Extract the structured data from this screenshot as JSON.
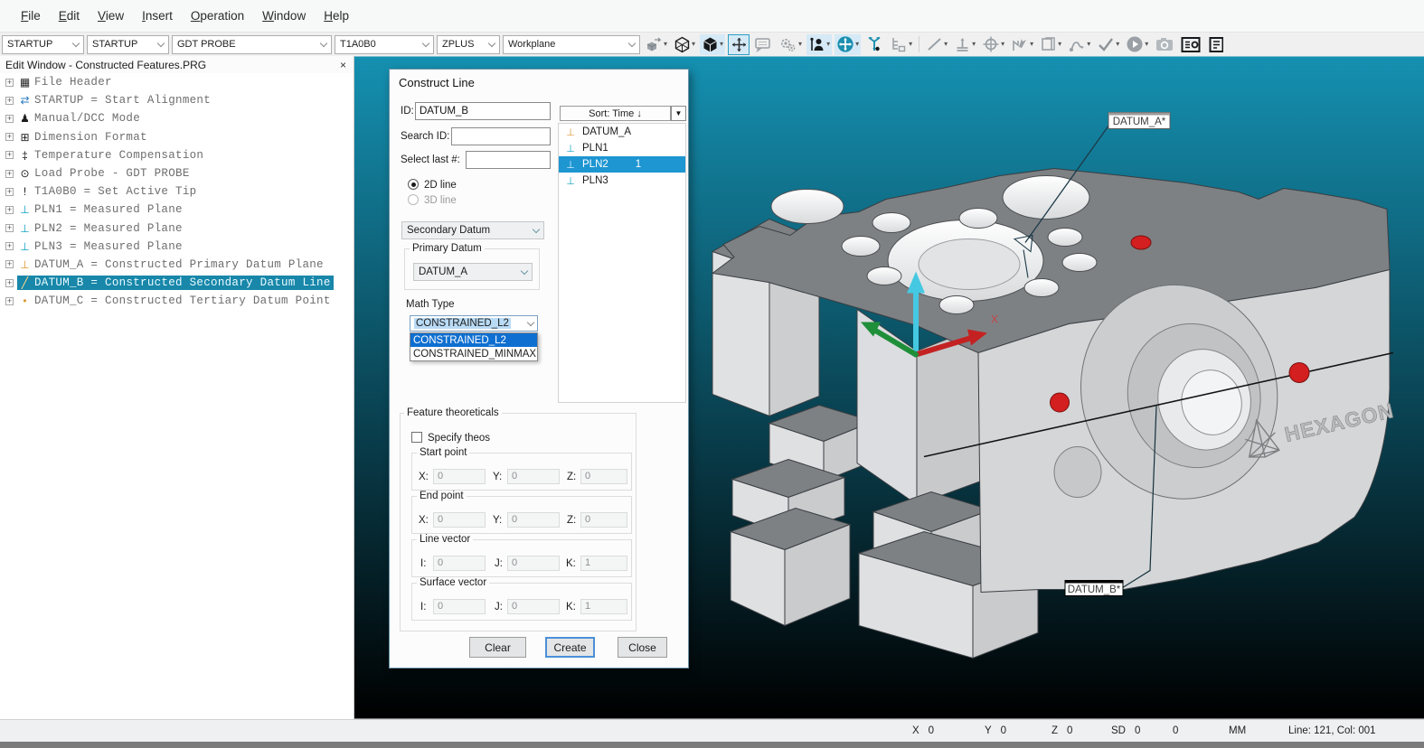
{
  "menu": {
    "items": [
      {
        "label": "File"
      },
      {
        "label": "Edit"
      },
      {
        "label": "View"
      },
      {
        "label": "Insert"
      },
      {
        "label": "Operation"
      },
      {
        "label": "Window"
      },
      {
        "label": "Help"
      }
    ]
  },
  "toolbar": {
    "caret_glyph": "▾",
    "combos": [
      {
        "value": "STARTUP"
      },
      {
        "value": "STARTUP"
      },
      {
        "value": "GDT PROBE"
      },
      {
        "value": "T1A0B0"
      },
      {
        "value": "ZPLUS"
      },
      {
        "value": "Workplane"
      }
    ],
    "icons": [
      "view-orientation-icon",
      "wireframe-view-icon",
      "solid-view-icon",
      "pan-view-icon",
      "comment-icon",
      "settings-gears-icon",
      "manual-mode-icon",
      "machine-move-icon",
      "probe-vector-icon",
      "feature-tree-icon",
      "line-feature-icon",
      "perpendicular-feature-icon",
      "target-feature-icon",
      "move-vector-icon",
      "copy-window-icon",
      "path-icon",
      "check-icon",
      "execute-icon",
      "camera-icon",
      "report-window-icon",
      "edit-window-icon"
    ]
  },
  "tree": {
    "title": "Edit Window - Constructed Features.PRG",
    "close_glyph": "×",
    "expander_glyph": "+",
    "items": [
      {
        "icon": "file-header-icon",
        "glyph": "▦",
        "label": "File Header"
      },
      {
        "icon": "alignment-icon",
        "glyph": "⇄",
        "label": "STARTUP = Start Alignment"
      },
      {
        "icon": "manual-dcc-icon",
        "glyph": "♟",
        "label": "Manual/DCC Mode"
      },
      {
        "icon": "dimension-icon",
        "glyph": "⊞",
        "label": "Dimension Format"
      },
      {
        "icon": "temperature-icon",
        "glyph": "‡",
        "label": "Temperature Compensation"
      },
      {
        "icon": "load-probe-icon",
        "glyph": "⊙",
        "label": "Load Probe - GDT PROBE"
      },
      {
        "icon": "active-tip-icon",
        "glyph": "!",
        "label": "T1A0B0 = Set Active Tip"
      },
      {
        "icon": "measured-plane-icon",
        "glyph": "⊥",
        "label": "PLN1 = Measured Plane"
      },
      {
        "icon": "measured-plane-icon",
        "glyph": "⊥",
        "label": "PLN2 = Measured Plane"
      },
      {
        "icon": "measured-plane-icon",
        "glyph": "⊥",
        "label": "PLN3 = Measured Plane"
      },
      {
        "icon": "datum-plane-icon",
        "glyph": "⊥",
        "label": "DATUM_A = Constructed Primary Datum Plane"
      },
      {
        "icon": "datum-line-icon",
        "glyph": "╱",
        "label": "DATUM_B = Constructed Secondary Datum Line",
        "selected": true
      },
      {
        "icon": "datum-point-icon",
        "glyph": "•",
        "label": "DATUM_C = Constructed Tertiary Datum Point"
      }
    ]
  },
  "dialog": {
    "title": "Construct Line",
    "id_label": "ID:",
    "id_value": "DATUM_B",
    "search_label": "Search ID:",
    "select_last_label": "Select last #:",
    "radio_2d": "2D line",
    "radio_3d": "3D line",
    "secondary_combo": "Secondary Datum",
    "primary_group": "Primary Datum",
    "primary_value": "DATUM_A",
    "math_label": "Math Type",
    "math_value": "CONSTRAINED_L2",
    "math_options": [
      {
        "label": "CONSTRAINED_L2",
        "selected": true
      },
      {
        "label": "CONSTRAINED_MINMAX"
      }
    ],
    "sort_label": "Sort: Time ↓",
    "sort_caret": "▼",
    "list": [
      {
        "glyph": "⊥",
        "name": "DATUM_A",
        "type": "constructed-datum"
      },
      {
        "glyph": "⊥",
        "name": "PLN1",
        "type": "measured"
      },
      {
        "glyph": "⊥",
        "name": "PLN2",
        "count": "1",
        "type": "measured",
        "selected": true
      },
      {
        "glyph": "⊥",
        "name": "PLN3",
        "type": "measured"
      }
    ],
    "theo_group": "Feature theoreticals",
    "specify_theos": "Specify theos",
    "start_group": "Start point",
    "end_group": "End point",
    "line_group": "Line vector",
    "surface_group": "Surface vector",
    "lbl": {
      "x": "X:",
      "y": "Y:",
      "z": "Z:",
      "i": "I:",
      "j": "J:",
      "k": "K:"
    },
    "start": {
      "x": "0",
      "y": "0",
      "z": "0"
    },
    "end": {
      "x": "0",
      "y": "0",
      "z": "0"
    },
    "line_vec": {
      "i": "0",
      "j": "0",
      "k": "1"
    },
    "surf_vec": {
      "i": "0",
      "j": "0",
      "k": "1"
    },
    "buttons": {
      "clear": "Clear",
      "create": "Create",
      "close": "Close"
    }
  },
  "viewport": {
    "bg_color": "#1489a9",
    "labels": {
      "datum_a": "DATUM_A*",
      "datum_b": "DATUM_B*"
    },
    "logo": "HEXAGON",
    "axis_x": "X",
    "measurement_point_color": "#d31f1f"
  },
  "statusbar": {
    "axes": [
      {
        "label": "X",
        "value": "0"
      },
      {
        "label": "Y",
        "value": "0"
      },
      {
        "label": "Z",
        "value": "0"
      },
      {
        "label": "SD",
        "value": "0"
      }
    ],
    "extra": "0",
    "units": "MM",
    "caret_pos": "Line: 121, Col: 001"
  }
}
